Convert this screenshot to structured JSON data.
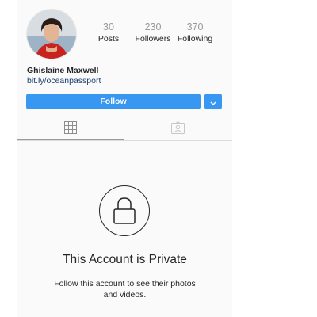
{
  "profile": {
    "name": "Ghislaine Maxwell",
    "link": "bit.ly/oceanpassport"
  },
  "stats": [
    {
      "value": "30",
      "label": "Posts"
    },
    {
      "value": "230",
      "label": "Followers"
    },
    {
      "value": "370",
      "label": "Following"
    }
  ],
  "actions": {
    "follow_label": "Follow"
  },
  "private": {
    "title": "This Account is Private",
    "description": "Follow this account to see their photos and videos."
  },
  "colors": {
    "accent": "#3897f0",
    "link": "#1b3f6e",
    "background": "#fafafa"
  },
  "icons": {
    "grid_tab": "grid-icon",
    "tagged_tab": "tagged-photos-icon",
    "lock": "lock-icon",
    "dropdown": "chevron-down-icon"
  }
}
